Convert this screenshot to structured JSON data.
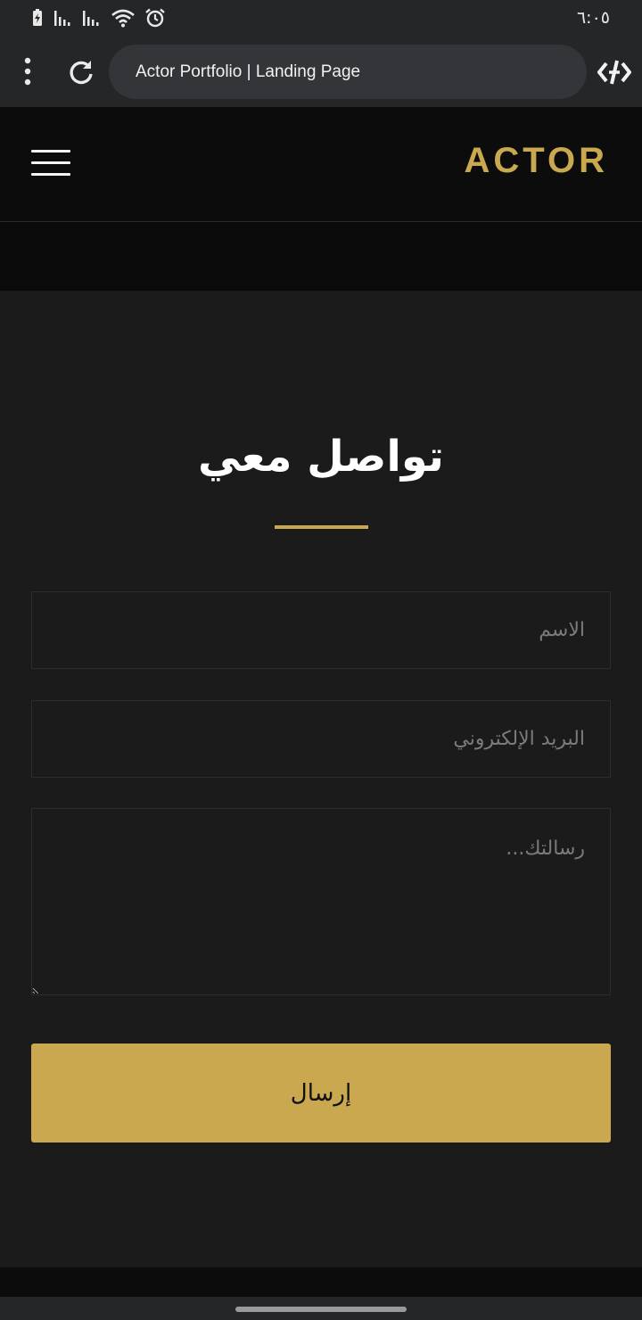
{
  "status_bar": {
    "time": "٦:٠٥",
    "icons": [
      "battery-charging-icon",
      "signal-bars-icon",
      "signal-bars-icon",
      "wifi-icon",
      "alarm-icon"
    ]
  },
  "browser": {
    "page_title": "Actor Portfolio | Landing Page",
    "icons": [
      "menu-dots-icon",
      "reload-icon",
      "developer-tools-icon"
    ]
  },
  "header": {
    "brand": "ACTOR",
    "menu_icon": "hamburger-menu-icon"
  },
  "contact": {
    "title": "تواصل معي",
    "name_placeholder": "الاسم",
    "email_placeholder": "البريد الإلكتروني",
    "message_placeholder": "رسالتك...",
    "submit_label": "إرسال"
  },
  "colors": {
    "accent": "#c9a84f",
    "background": "#1b1b1c",
    "header_background": "#0c0c0d",
    "chrome": "#252628"
  }
}
